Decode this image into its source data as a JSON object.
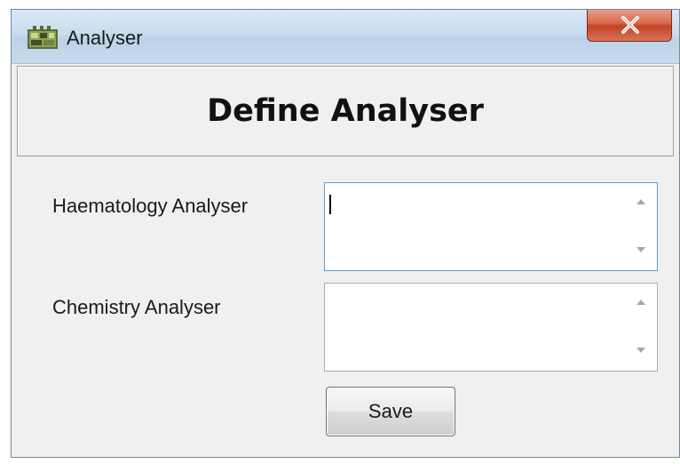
{
  "window": {
    "title": "Analyser",
    "icon": "analyser-app-icon",
    "close_label": "X"
  },
  "header": {
    "title": "Define Analyser"
  },
  "form": {
    "haematology": {
      "label": "Haematology Analyser",
      "value": "",
      "focused": true
    },
    "chemistry": {
      "label": "Chemistry Analyser",
      "value": ""
    }
  },
  "actions": {
    "save_label": "Save"
  },
  "icons": {
    "scroll_up": "chevron-up-icon",
    "scroll_down": "chevron-down-icon",
    "close": "close-icon"
  },
  "colors": {
    "close_button": "#c24326",
    "titlebar": "#c9dced",
    "focus_border": "#5b9bd5"
  }
}
